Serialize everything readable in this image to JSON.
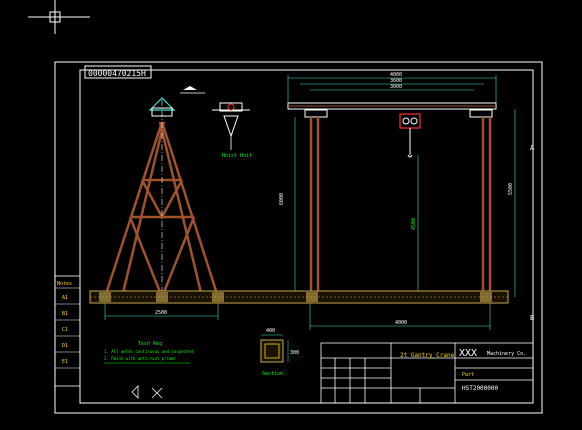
{
  "drawing": {
    "code_box": "00000470215H",
    "dim_top_outer": "4000",
    "dim_top_mid": "3600",
    "dim_top_inner": "3000",
    "dim_left_height": "6000",
    "dim_right_height": "5500",
    "dim_hook_height": "4500",
    "dim_a_base": "2500",
    "dim_bottom_span": "4000",
    "dim_section_w": "400",
    "dim_section_h": "300",
    "hoist_label": "Hoist Unit",
    "notes_title": "Tech Req",
    "notes": [
      "1. All welds continuous and inspected",
      "2. Paint with anti-rust primer"
    ],
    "section_label": "Section",
    "grid_a_top": "A",
    "grid_b": "B",
    "title_company": "XXX",
    "title_company_sub": "Machinery Co.",
    "title_product": "2t Gantry Crane",
    "title_unit": "Part",
    "title_drawing_no": "HST2000000",
    "side_labels": [
      "Notes",
      "A1",
      "B1",
      "C1",
      "D1",
      "E1"
    ]
  },
  "colors": {
    "background": "#000000",
    "frame": "#ffffff",
    "member": "#a0522d",
    "rail": "#c8a850",
    "dimension": "#40e0d0",
    "accent_green": "#00ff00",
    "accent_yellow": "#ffd700",
    "hoist": "#ff3030",
    "title_block": "#ffffff"
  }
}
